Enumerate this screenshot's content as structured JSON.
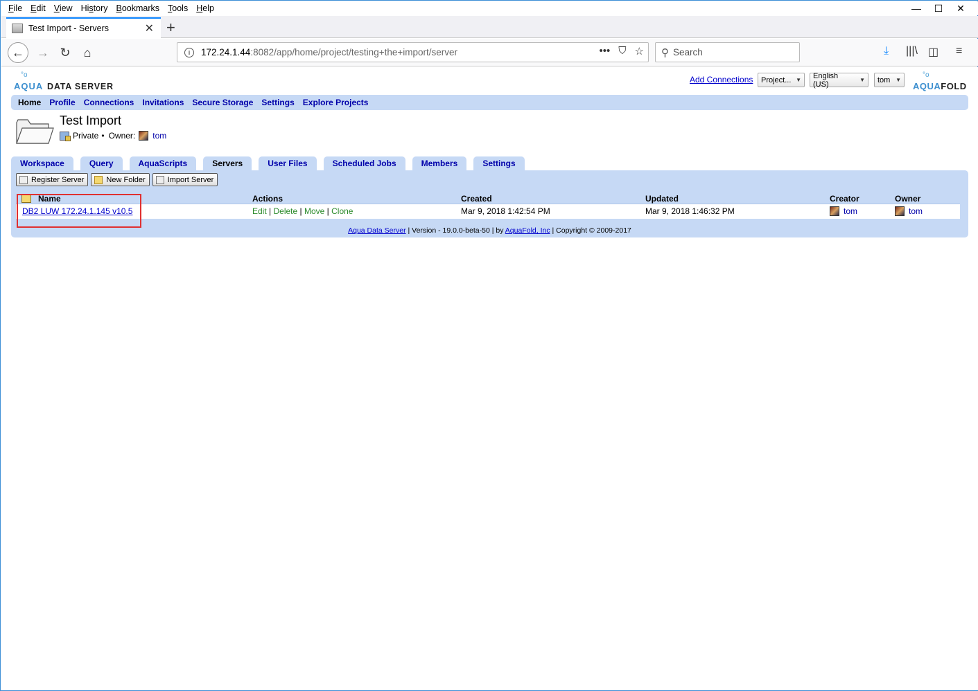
{
  "browser": {
    "menu": [
      "File",
      "Edit",
      "View",
      "History",
      "Bookmarks",
      "Tools",
      "Help"
    ],
    "window_controls": {
      "minimize": "—",
      "maximize": "☐",
      "close": "✕"
    },
    "tab_title": "Test Import - Servers",
    "url_host": "172.24.1.44",
    "url_path": ":8082/app/home/project/testing+the+import/server",
    "search_placeholder": "Search"
  },
  "header": {
    "logo_left_aqua": "AQUA",
    "logo_left_rest": "DATA SERVER",
    "logo_right_aqua": "AQUA",
    "logo_right_fold": "FOLD",
    "add_connections": "Add Connections",
    "project_select": "Project...",
    "language_select": "English (US)",
    "user_select": "tom"
  },
  "main_nav": [
    "Home",
    "Profile",
    "Connections",
    "Invitations",
    "Secure Storage",
    "Settings",
    "Explore Projects"
  ],
  "project": {
    "title": "Test Import",
    "visibility": "Private",
    "owner_label": "Owner:",
    "owner": "tom"
  },
  "sub_tabs": [
    "Workspace",
    "Query",
    "AquaScripts",
    "Servers",
    "User Files",
    "Scheduled Jobs",
    "Members",
    "Settings"
  ],
  "active_sub_tab": "Servers",
  "toolbar": {
    "register_server": "Register Server",
    "new_folder": "New Folder",
    "import_server": "Import Server"
  },
  "table": {
    "headers": {
      "name": "Name",
      "actions": "Actions",
      "created": "Created",
      "updated": "Updated",
      "creator": "Creator",
      "owner": "Owner"
    },
    "rows": [
      {
        "name": "DB2 LUW 172.24.1.145 v10.5",
        "actions": [
          "Edit",
          "Delete",
          "Move",
          "Clone"
        ],
        "created": "Mar 9, 2018 1:42:54 PM",
        "updated": "Mar 9, 2018 1:46:32 PM",
        "creator": "tom",
        "owner": "tom"
      }
    ]
  },
  "footer": {
    "product": "Aqua Data Server",
    "version": " | Version - 19.0.0-beta-50 | by ",
    "company": "AquaFold, Inc",
    "copyright": " | Copyright © 2009-2017"
  },
  "colors": {
    "nav_bg": "#c6d9f5",
    "link": "#0000aa",
    "action_link": "#2a8a2a",
    "highlight_box": "#e03030"
  }
}
